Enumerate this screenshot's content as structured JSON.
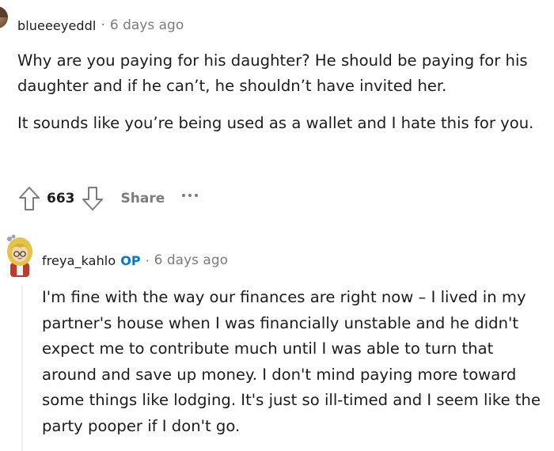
{
  "comments": [
    {
      "username": "blueeeyeddl",
      "separator": "·",
      "time": "6 days ago",
      "paragraphs": [
        "Why are you paying for his daughter? He should be paying for his daughter and if he can’t, he shouldn’t have invited her.",
        "It sounds like you’re being used as a wallet and I hate this for you."
      ],
      "votes": "663",
      "share_label": "Share"
    },
    {
      "username": "freya_kahlo",
      "badge": "OP",
      "separator": "·",
      "time": "6 days ago",
      "paragraphs": [
        "I'm fine with the way our finances are right now – I lived in my partner's house when I was financially unstable and he didn't expect me to contribute much until I was able to turn that around and save up money. I don't mind paying more toward some things like lodging. It's just so ill-timed and I seem like the party pooper if I don't go."
      ]
    }
  ],
  "icons": {
    "upvote": "upvote-arrow-icon",
    "downvote": "downvote-arrow-icon",
    "more": "more-options-icon"
  },
  "colors": {
    "text": "#1c1c1c",
    "meta": "#7c7c7c",
    "op_badge": "#0079d3"
  }
}
